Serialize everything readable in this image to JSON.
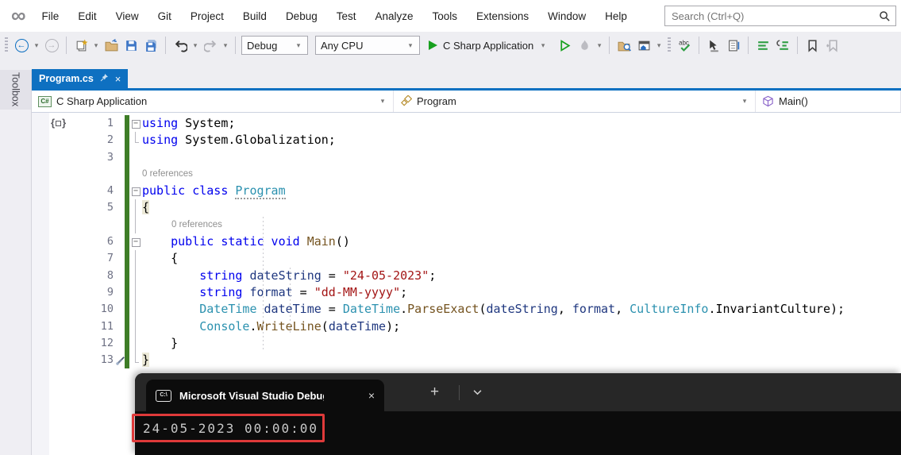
{
  "menu": {
    "items": [
      "File",
      "Edit",
      "View",
      "Git",
      "Project",
      "Build",
      "Debug",
      "Test",
      "Analyze",
      "Tools",
      "Extensions",
      "Window",
      "Help"
    ],
    "search_placeholder": "Search (Ctrl+Q)"
  },
  "toolbar": {
    "config": "Debug",
    "platform": "Any CPU",
    "start_label": "C Sharp Application"
  },
  "left_rail": {
    "toolbox_label": "Toolbox"
  },
  "doc_tab": {
    "title": "Program.cs"
  },
  "navbar": {
    "project": "C Sharp Application",
    "type": "Program",
    "member": "Main()"
  },
  "editor": {
    "codelens_label": "0 references",
    "lines": [
      {
        "n": "1",
        "fold": "box",
        "segs": [
          [
            "kw",
            "using"
          ],
          [
            "pl",
            " System;"
          ]
        ]
      },
      {
        "n": "2",
        "fold": "end",
        "segs": [
          [
            "kw",
            "using"
          ],
          [
            "pl",
            " System.Globalization;"
          ]
        ]
      },
      {
        "n": "3",
        "fold": "",
        "segs": []
      },
      {
        "lens": true,
        "il": 0,
        "fold": ""
      },
      {
        "n": "4",
        "fold": "box",
        "segs": [
          [
            "kw",
            "public class "
          ],
          [
            "cls u",
            "Program"
          ]
        ]
      },
      {
        "n": "5",
        "fold": "line",
        "segs": [
          [
            "pl hlb",
            "{"
          ]
        ]
      },
      {
        "lens": true,
        "il": 1,
        "fold": "line"
      },
      {
        "n": "6",
        "fold": "box",
        "segs": [
          [
            "pl",
            "    "
          ],
          [
            "kw",
            "public static void "
          ],
          [
            "meth",
            "Main"
          ],
          [
            "pl",
            "()"
          ]
        ]
      },
      {
        "n": "7",
        "fold": "line",
        "segs": [
          [
            "pl",
            "    {"
          ]
        ]
      },
      {
        "n": "8",
        "fold": "line",
        "segs": [
          [
            "pl",
            "        "
          ],
          [
            "kw",
            "string"
          ],
          [
            "pl",
            " "
          ],
          [
            "var",
            "dateString"
          ],
          [
            "pl",
            " = "
          ],
          [
            "str",
            "\"24-05-2023\""
          ],
          [
            "pl",
            ";"
          ]
        ]
      },
      {
        "n": "9",
        "fold": "line",
        "segs": [
          [
            "pl",
            "        "
          ],
          [
            "kw",
            "string"
          ],
          [
            "pl",
            " "
          ],
          [
            "var",
            "format"
          ],
          [
            "pl",
            " = "
          ],
          [
            "str",
            "\"dd-MM-yyyy\""
          ],
          [
            "pl",
            ";"
          ]
        ]
      },
      {
        "n": "10",
        "fold": "line",
        "segs": [
          [
            "pl",
            "        "
          ],
          [
            "cls",
            "DateTime"
          ],
          [
            "pl",
            " "
          ],
          [
            "var",
            "dateTime"
          ],
          [
            "pl",
            " = "
          ],
          [
            "cls",
            "DateTime"
          ],
          [
            "pl",
            "."
          ],
          [
            "meth",
            "ParseExact"
          ],
          [
            "pl",
            "("
          ],
          [
            "var",
            "dateString"
          ],
          [
            "pl",
            ", "
          ],
          [
            "var",
            "format"
          ],
          [
            "pl",
            ", "
          ],
          [
            "cls",
            "CultureInfo"
          ],
          [
            "pl",
            ".InvariantCulture);"
          ]
        ]
      },
      {
        "n": "11",
        "fold": "line",
        "segs": [
          [
            "pl",
            "        "
          ],
          [
            "cls",
            "Console"
          ],
          [
            "pl",
            "."
          ],
          [
            "meth",
            "WriteLine"
          ],
          [
            "pl",
            "("
          ],
          [
            "var",
            "dateTime"
          ],
          [
            "pl",
            ");"
          ]
        ]
      },
      {
        "n": "12",
        "fold": "line",
        "segs": [
          [
            "pl",
            "    }"
          ]
        ]
      },
      {
        "n": "13",
        "fold": "end",
        "tool": true,
        "segs": [
          [
            "pl hlb",
            "}"
          ]
        ]
      }
    ]
  },
  "terminal": {
    "tab_title": "Microsoft Visual Studio Debug",
    "output": "24-05-2023 00:00:00"
  },
  "colors": {
    "accent_blue": "#0e70c1",
    "annotation_red": "#df3a3a",
    "change_bar_green": "#3e7d27",
    "run_green": "#17a01e",
    "terminal_bg": "#0c0c0c",
    "terminal_bar": "#272727"
  }
}
